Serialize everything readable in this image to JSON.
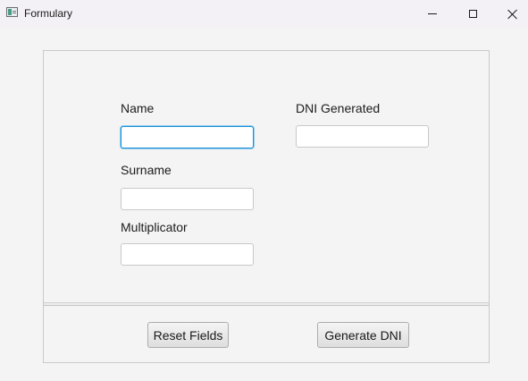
{
  "window": {
    "title": "Formulary",
    "icon": "java-app-icon",
    "controls": [
      "minimize",
      "maximize",
      "close"
    ]
  },
  "form": {
    "name_label": "Name",
    "name_value": "",
    "surname_label": "Surname",
    "surname_value": "",
    "multiplicator_label": "Multiplicator",
    "multiplicator_value": "",
    "dni_label": "DNI Generated",
    "dni_value": ""
  },
  "actions": {
    "reset_label": "Reset Fields",
    "generate_label": "Generate DNI"
  },
  "colors": {
    "focus_border": "#1e90d6",
    "background": "#f4f4f4"
  }
}
